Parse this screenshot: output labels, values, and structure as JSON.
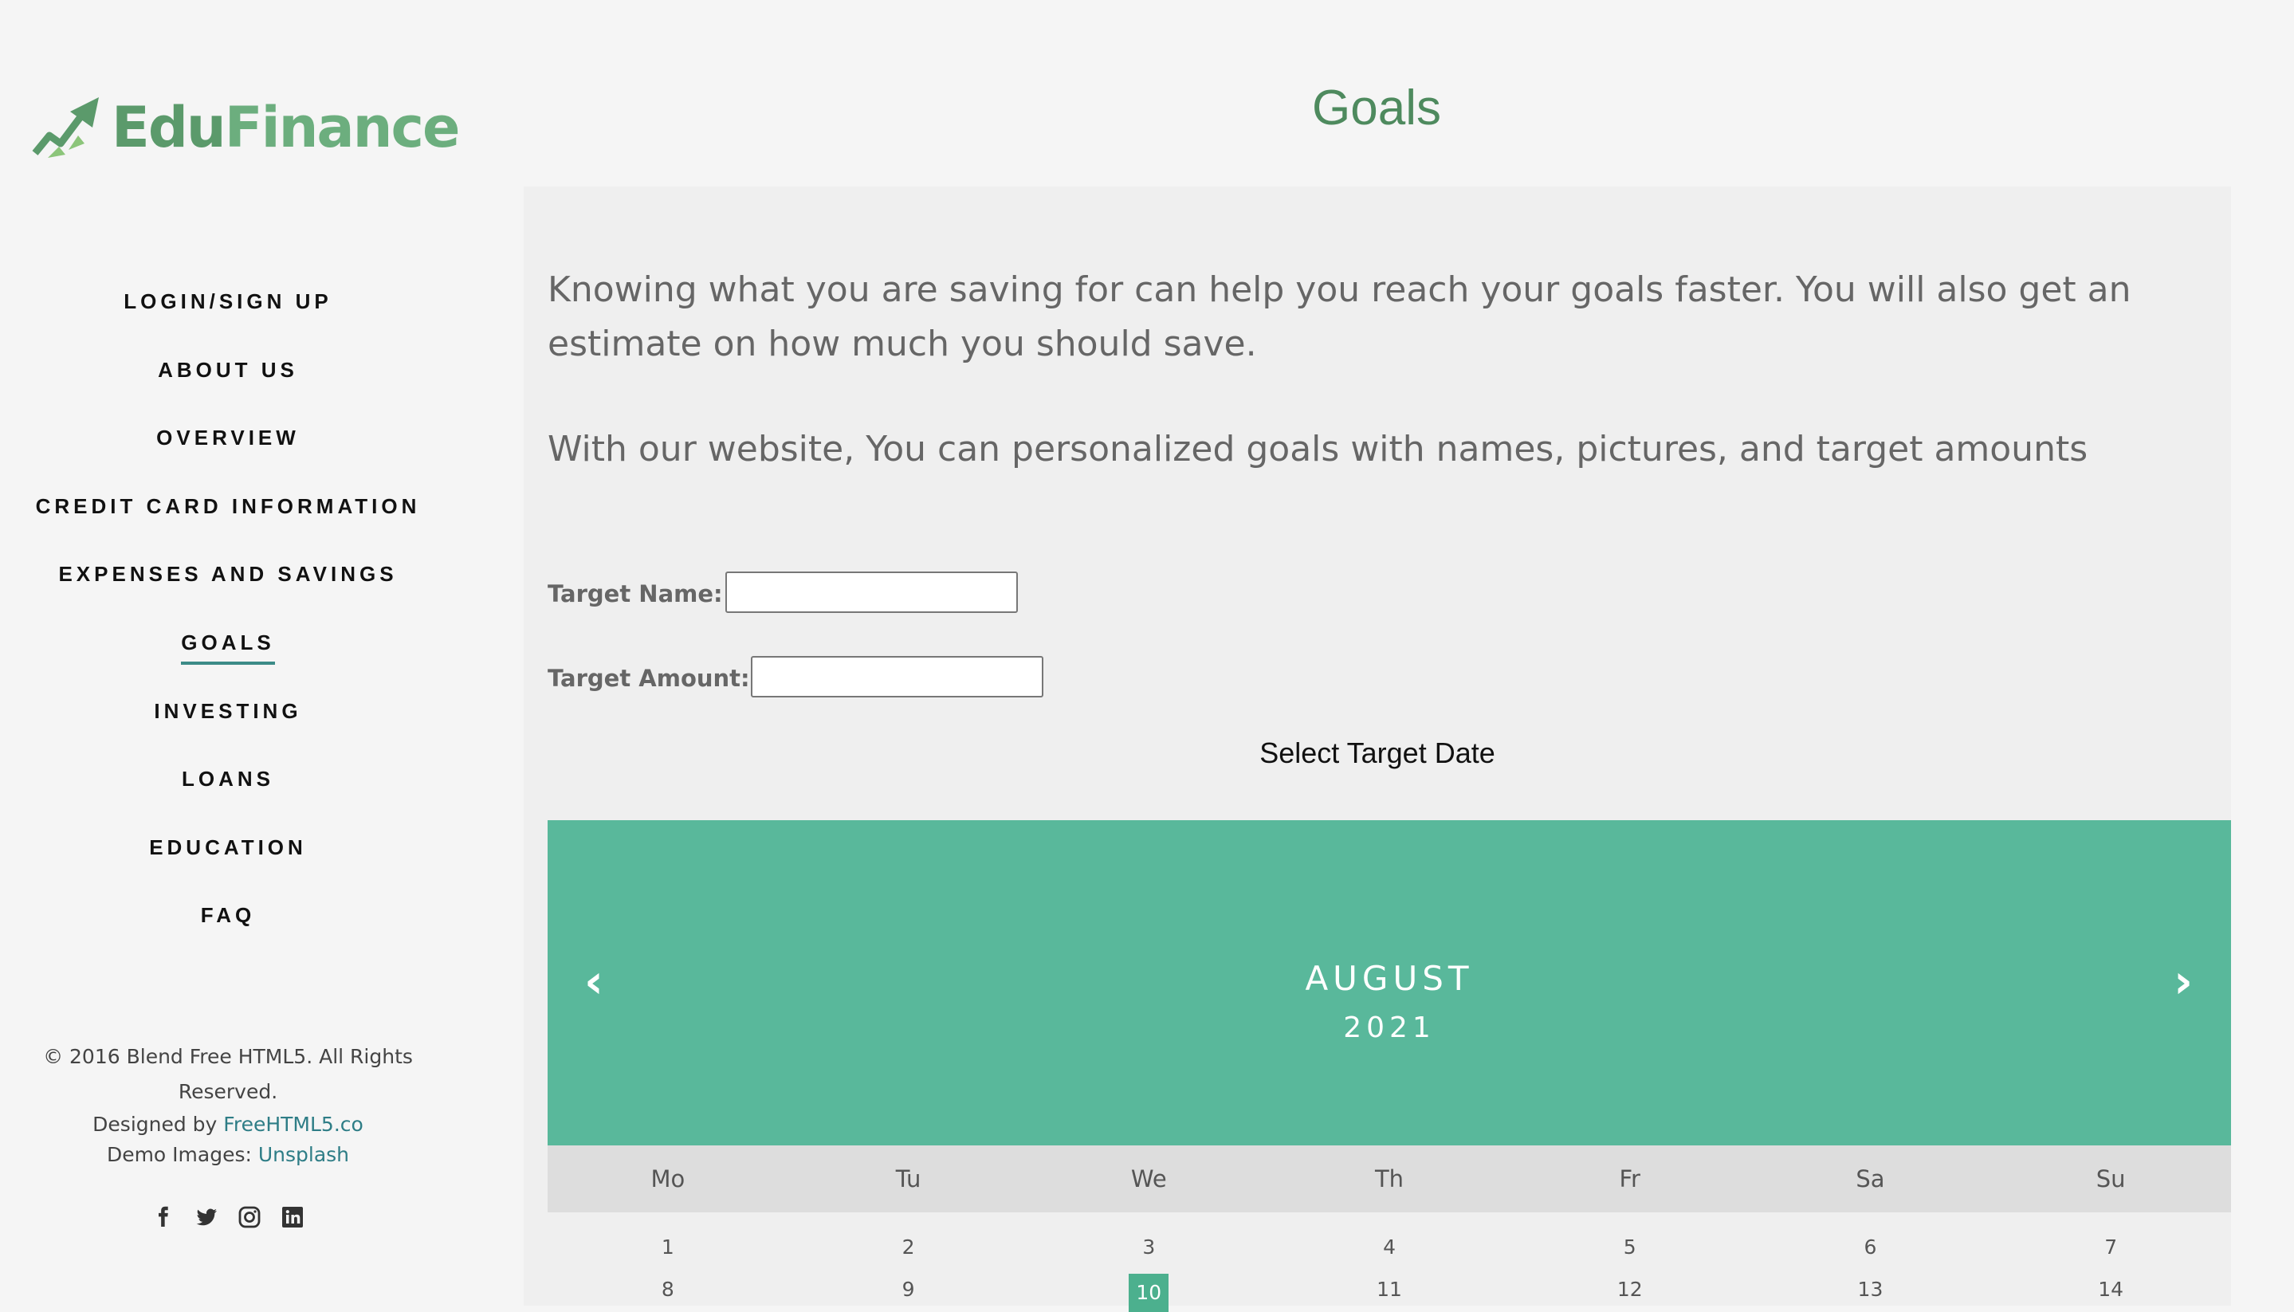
{
  "brand": {
    "name_part1": "Edu",
    "name_part2": "Finance"
  },
  "nav": [
    {
      "label": "LOGIN/SIGN UP",
      "active": false
    },
    {
      "label": "ABOUT US",
      "active": false
    },
    {
      "label": "OVERVIEW",
      "active": false
    },
    {
      "label": "CREDIT CARD INFORMATION",
      "active": false
    },
    {
      "label": "EXPENSES AND SAVINGS",
      "active": false
    },
    {
      "label": "GOALS",
      "active": true
    },
    {
      "label": "INVESTING",
      "active": false
    },
    {
      "label": "LOANS",
      "active": false
    },
    {
      "label": "EDUCATION",
      "active": false
    },
    {
      "label": "FAQ",
      "active": false
    }
  ],
  "footer": {
    "copyright": "© 2016 Blend Free HTML5. All Rights Reserved.",
    "designed_prefix": "Designed by ",
    "designed_link": "FreeHTML5.co",
    "images_prefix": "Demo Images: ",
    "images_link": "Unsplash"
  },
  "social_icons": [
    "facebook-icon",
    "twitter-icon",
    "instagram-icon",
    "linkedin-icon"
  ],
  "page": {
    "title": "Goals",
    "intro1": "Knowing what you are saving for can help you reach your goals faster. You will also get an estimate on how much you should save.",
    "intro2": "With our website, You can personalized goals with names, pictures, and target amounts"
  },
  "form": {
    "target_name_label": "Target Name:",
    "target_name_value": "",
    "target_amount_label": "Target Amount:",
    "target_amount_value": "",
    "select_date_label": "Select Target Date"
  },
  "calendar": {
    "month": "AUGUST",
    "year": "2021",
    "prev_symbol": "‹",
    "next_symbol": "›",
    "weekdays": [
      "Mo",
      "Tu",
      "We",
      "Th",
      "Fr",
      "Sa",
      "Su"
    ],
    "week1": [
      "1",
      "2",
      "3",
      "4",
      "5",
      "6",
      "7"
    ],
    "week2": [
      "8",
      "9",
      "10",
      "11",
      "12",
      "13",
      "14"
    ],
    "selected_day": "10"
  },
  "colors": {
    "accent": "#59b89b",
    "brand_dark": "#5b9a6b",
    "title": "#4e8a5e",
    "link": "#2e7d86"
  }
}
